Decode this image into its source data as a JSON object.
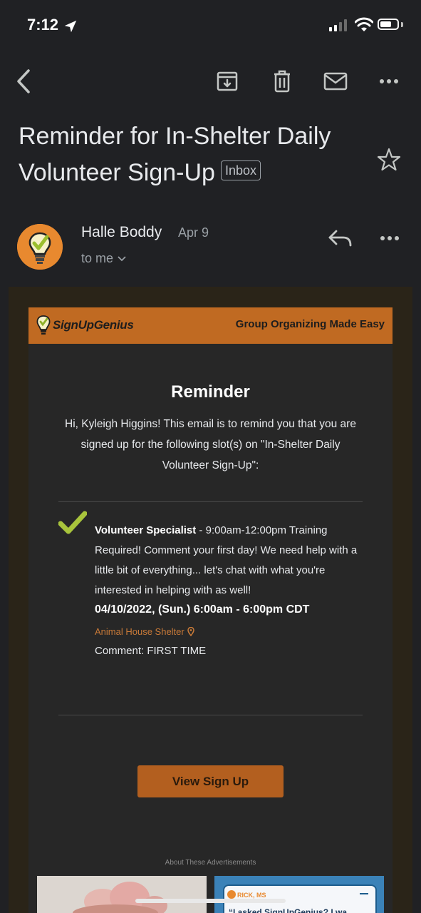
{
  "status_bar": {
    "time": "7:12"
  },
  "toolbar": {
    "back_icon": "chevron-left-icon",
    "archive_icon": "archive-icon",
    "delete_icon": "trash-icon",
    "mark_unread_icon": "mail-icon",
    "more_icon": "more-horizontal-icon"
  },
  "email": {
    "subject": "Reminder for In-Shelter Daily Volunteer Sign-Up",
    "label": "Inbox",
    "sender": "Halle Boddy",
    "date": "Apr 9",
    "recipient": "to me"
  },
  "body": {
    "brand": "SignUpGenius",
    "tagline": "Group Organizing Made Easy",
    "title": "Reminder",
    "intro": "Hi, Kyleigh Higgins! This email is to remind you that you are signed up for the following slot(s) on \"In-Shelter Daily Volunteer Sign-Up\":",
    "slot": {
      "role": "Volunteer Specialist",
      "description": " - 9:00am-12:00pm Training Required! Comment your first day! We need help with a little bit of everything... let's chat with what you're interested in helping with as well!",
      "datetime": "04/10/2022, (Sun.) 6:00am - 6:00pm CDT",
      "location": "Animal House Shelter",
      "comment": "Comment: FIRST TIME"
    },
    "button_label": "View Sign Up",
    "ads_label": "About These Advertisements",
    "ad_right": {
      "tag": "RICK, MS",
      "quote": "“I asked SignUpGenius? I wa"
    }
  },
  "colors": {
    "background": "#202124",
    "brand_orange": "#c06a22",
    "button": "#b35f1f",
    "check_green": "#a8c43c",
    "location_link": "#c97a38"
  }
}
